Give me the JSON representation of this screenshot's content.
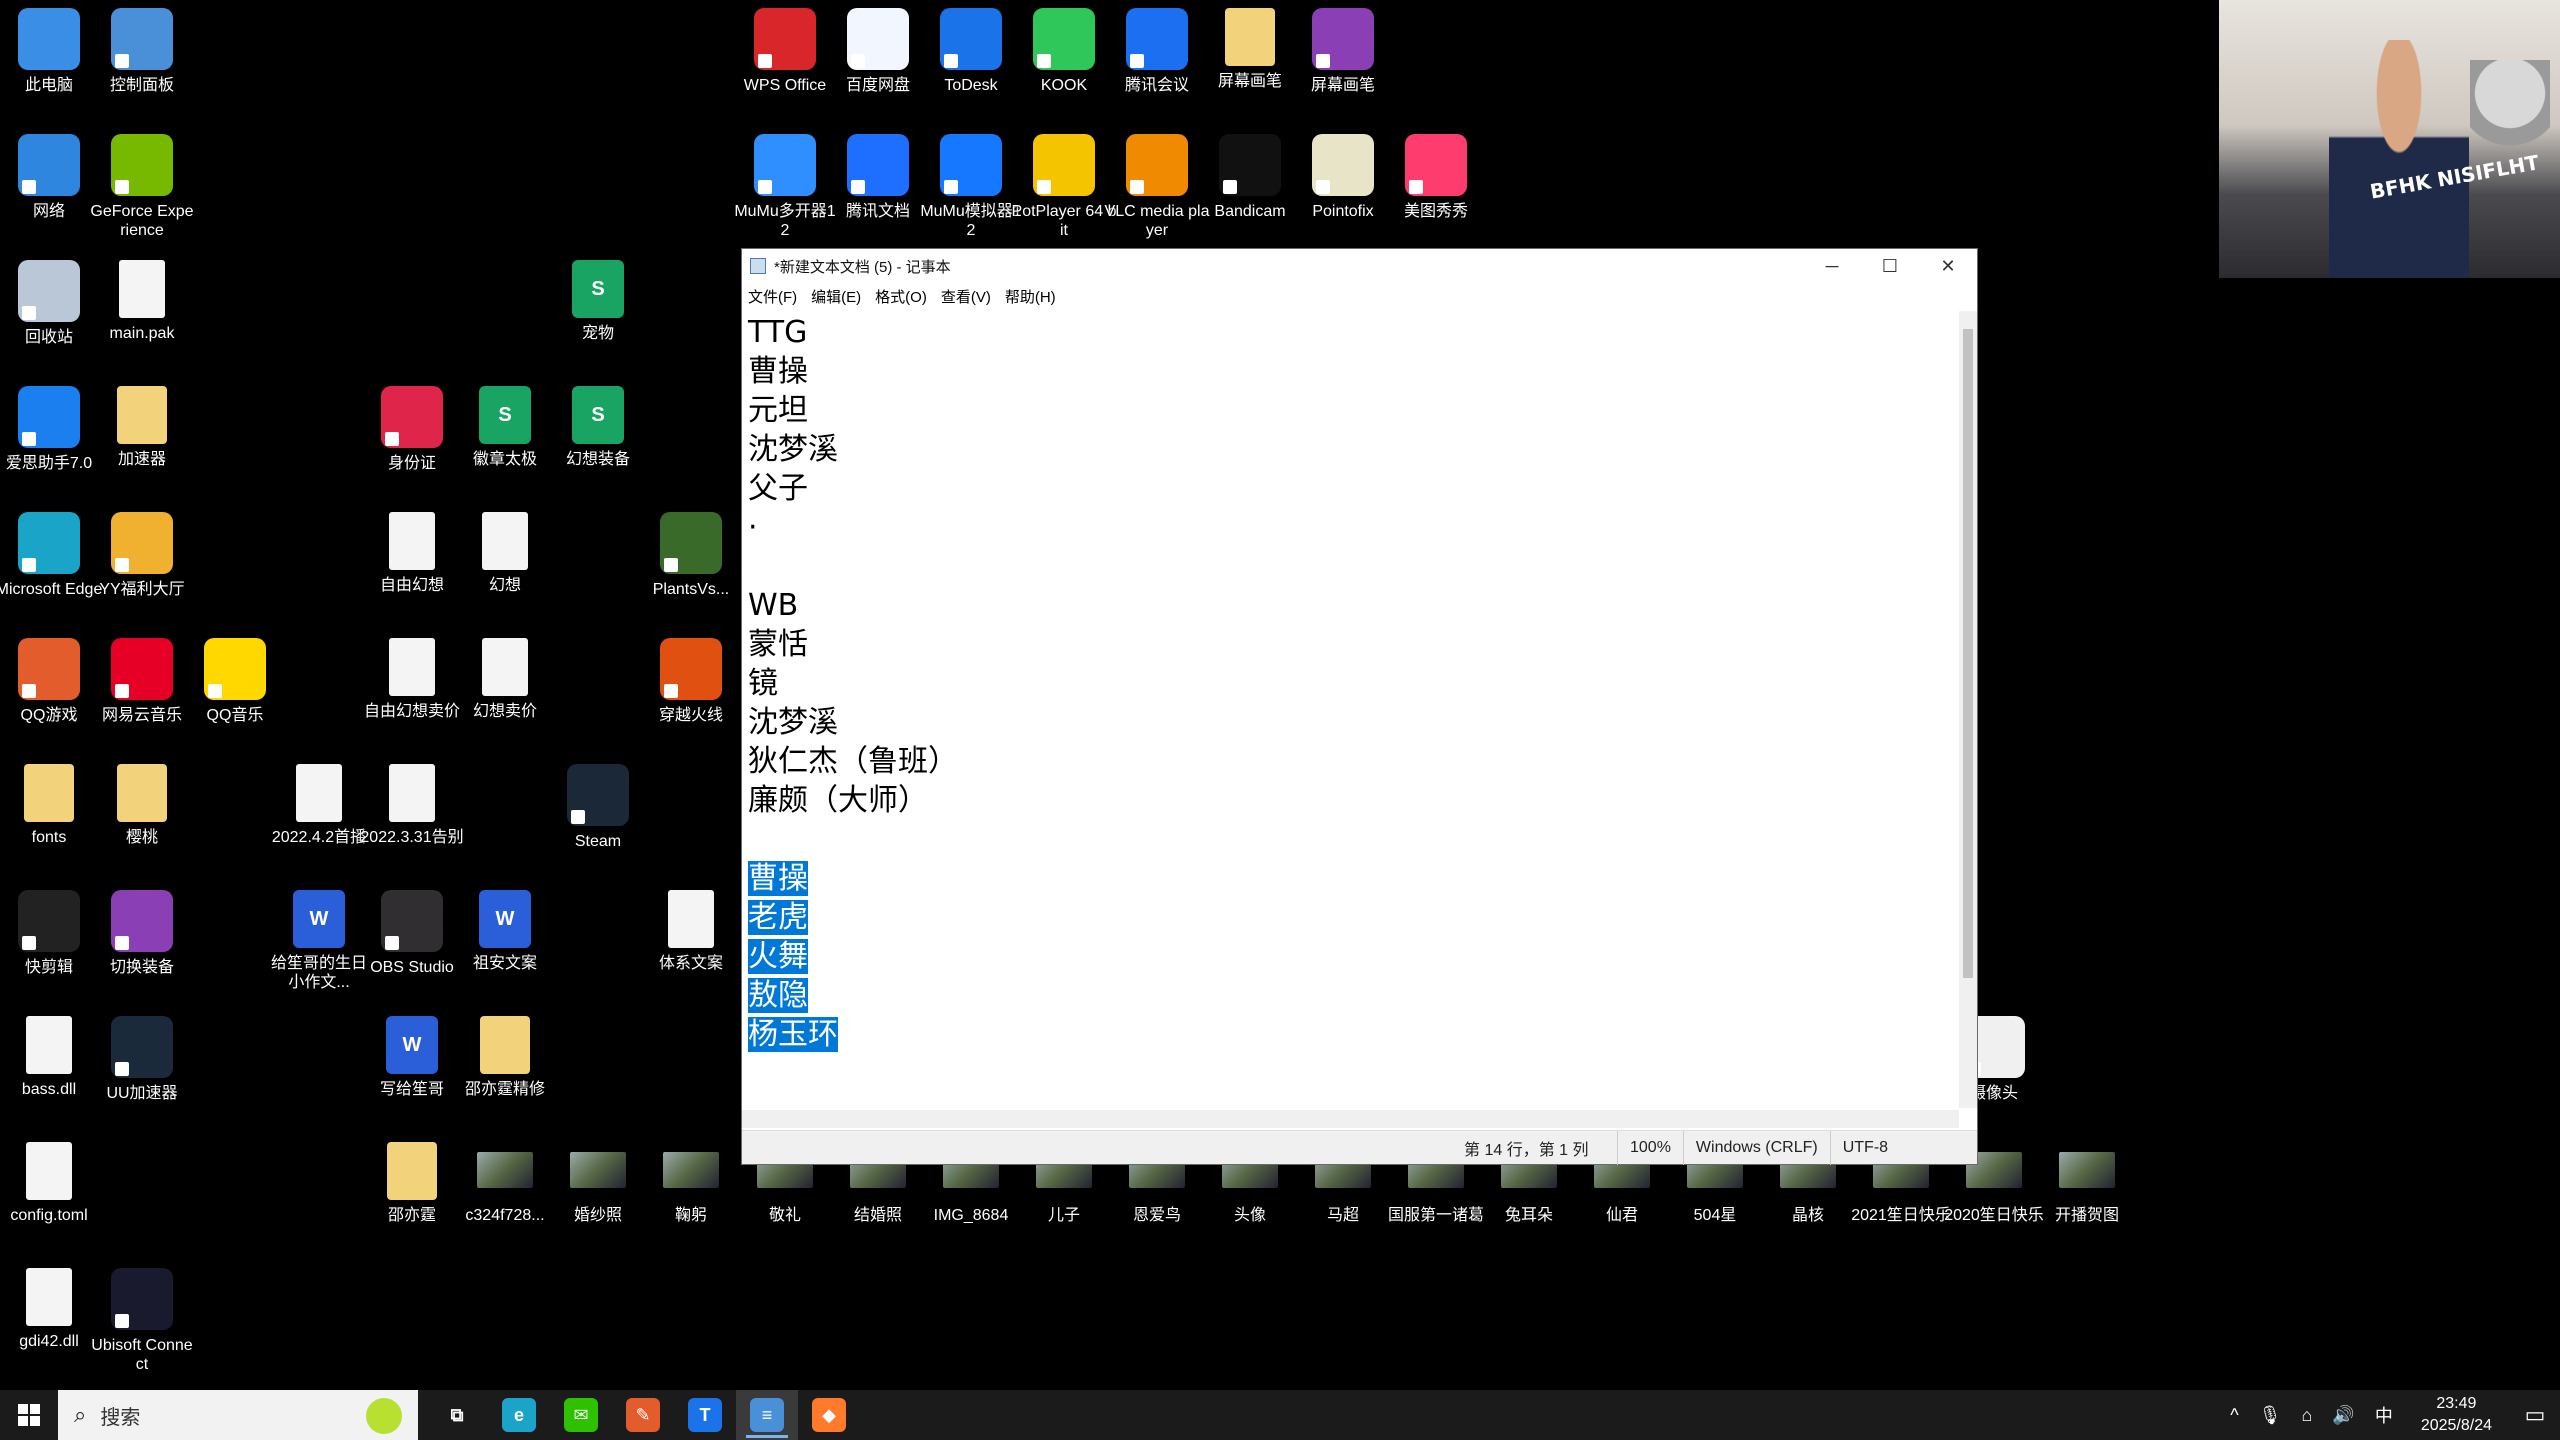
{
  "desktop_icons": [
    {
      "label": "此电脑",
      "kind": "pc",
      "color": "#3a8ee6"
    },
    {
      "label": "控制面板",
      "kind": "app",
      "color": "#4a90d9"
    },
    {
      "label": "网络",
      "kind": "app",
      "color": "#2e86de"
    },
    {
      "label": "GeForce Experience",
      "kind": "app",
      "color": "#76b900"
    },
    {
      "label": "回收站",
      "kind": "app",
      "color": "#b9c7d6"
    },
    {
      "label": "main.pak",
      "kind": "doc",
      "color": "#f4f4f4"
    },
    {
      "label": "爱思助手7.0",
      "kind": "app",
      "color": "#1b7ff0"
    },
    {
      "label": "加速器",
      "kind": "folder",
      "color": "#f2d27a"
    },
    {
      "label": "Microsoft Edge",
      "kind": "app",
      "color": "#1aa4c8"
    },
    {
      "label": "YY福利大厅",
      "kind": "app",
      "color": "#f0b030"
    },
    {
      "label": "QQ游戏",
      "kind": "app",
      "color": "#e25c2c"
    },
    {
      "label": "网易云音乐",
      "kind": "app",
      "color": "#e60026"
    },
    {
      "label": "QQ音乐",
      "kind": "app",
      "color": "#ffd800"
    },
    {
      "label": "fonts",
      "kind": "folder",
      "color": "#f2d27a"
    },
    {
      "label": "樱桃",
      "kind": "folder",
      "color": "#f2d27a"
    },
    {
      "label": "快剪辑",
      "kind": "app",
      "color": "#222222"
    },
    {
      "label": "切换装备",
      "kind": "app",
      "color": "#8a3fb5"
    },
    {
      "label": "bass.dll",
      "kind": "doc",
      "color": "#f4f4f4"
    },
    {
      "label": "UU加速器",
      "kind": "app",
      "color": "#1a2a3a"
    },
    {
      "label": "config.toml",
      "kind": "doc",
      "color": "#f4f4f4"
    },
    {
      "label": "gdi42.dll",
      "kind": "doc",
      "color": "#f4f4f4"
    },
    {
      "label": "Ubisoft Connect",
      "kind": "app",
      "color": "#1a1a2e"
    },
    {
      "label": "身份证",
      "kind": "app",
      "color": "#e0254a"
    },
    {
      "label": "徽章太极",
      "kind": "sheet",
      "color": "#1aa463"
    },
    {
      "label": "幻想装备",
      "kind": "sheet",
      "color": "#1aa463"
    },
    {
      "label": "自由幻想",
      "kind": "doc",
      "color": "#f4f4f4"
    },
    {
      "label": "幻想",
      "kind": "doc",
      "color": "#f4f4f4"
    },
    {
      "label": "自由幻想卖价",
      "kind": "doc",
      "color": "#f4f4f4"
    },
    {
      "label": "幻想卖价",
      "kind": "doc",
      "color": "#f4f4f4"
    },
    {
      "label": "2022.4.2首播",
      "kind": "doc",
      "color": "#f4f4f4"
    },
    {
      "label": "2022.3.31告别",
      "kind": "doc",
      "color": "#f4f4f4"
    },
    {
      "label": "给笙哥的生日小作文...",
      "kind": "word",
      "color": "#2b5fd9"
    },
    {
      "label": "OBS Studio",
      "kind": "app",
      "color": "#302e31"
    },
    {
      "label": "祖安文案",
      "kind": "word",
      "color": "#2b5fd9"
    },
    {
      "label": "写给笙哥",
      "kind": "word",
      "color": "#2b5fd9"
    },
    {
      "label": "邵亦霆精修",
      "kind": "folder",
      "color": "#f2d27a"
    },
    {
      "label": "邵亦霆",
      "kind": "folder",
      "color": "#f2d27a"
    },
    {
      "label": "c324f728...",
      "kind": "photo",
      "color": "#888888"
    },
    {
      "label": "婚纱照",
      "kind": "photo",
      "color": "#888888"
    },
    {
      "label": "宠物",
      "kind": "sheet",
      "color": "#1aa463"
    },
    {
      "label": "PlantsVs...",
      "kind": "app",
      "color": "#3a6a2a"
    },
    {
      "label": "穿越火线",
      "kind": "app",
      "color": "#e05010"
    },
    {
      "label": "Steam",
      "kind": "app",
      "color": "#1b2838"
    },
    {
      "label": "体系文案",
      "kind": "doc",
      "color": "#f4f4f4"
    },
    {
      "label": "鞠躬",
      "kind": "photo",
      "color": "#888888"
    },
    {
      "label": "WPS Office",
      "kind": "app",
      "color": "#d9262b"
    },
    {
      "label": "百度网盘",
      "kind": "app",
      "color": "#f2f7ff"
    },
    {
      "label": "ToDesk",
      "kind": "app",
      "color": "#1a73e8"
    },
    {
      "label": "KOOK",
      "kind": "app",
      "color": "#30c75a"
    },
    {
      "label": "腾讯会议",
      "kind": "app",
      "color": "#1d6ff2"
    },
    {
      "label": "屏幕画笔",
      "kind": "folder",
      "color": "#f2d27a"
    },
    {
      "label": "屏幕画笔",
      "kind": "app",
      "color": "#8a3fb5"
    },
    {
      "label": "MuMu多开器12",
      "kind": "app",
      "color": "#2f8fff"
    },
    {
      "label": "腾讯文档",
      "kind": "app",
      "color": "#1e6fff"
    },
    {
      "label": "MuMu模拟器12",
      "kind": "app",
      "color": "#1678ff"
    },
    {
      "label": "PotPlayer 64 bit",
      "kind": "app",
      "color": "#f5c400"
    },
    {
      "label": "VLC media player",
      "kind": "app",
      "color": "#f08a00"
    },
    {
      "label": "Bandicam",
      "kind": "app",
      "color": "#111111"
    },
    {
      "label": "Pointofix",
      "kind": "app",
      "color": "#e8e4c8"
    },
    {
      "label": "美图秀秀",
      "kind": "app",
      "color": "#ff3c6e"
    },
    {
      "label": "敬礼",
      "kind": "photo",
      "color": "#888888"
    },
    {
      "label": "结婚照",
      "kind": "photo",
      "color": "#888888"
    },
    {
      "label": "IMG_8684",
      "kind": "photo",
      "color": "#888888"
    },
    {
      "label": "儿子",
      "kind": "photo",
      "color": "#888888"
    },
    {
      "label": "恩爱鸟",
      "kind": "photo",
      "color": "#888888"
    },
    {
      "label": "头像",
      "kind": "photo",
      "color": "#888888"
    },
    {
      "label": "马超",
      "kind": "photo",
      "color": "#888888"
    },
    {
      "label": "国服第一诸葛",
      "kind": "photo",
      "color": "#888888"
    },
    {
      "label": "兔耳朵",
      "kind": "photo",
      "color": "#888888"
    },
    {
      "label": "仙君",
      "kind": "photo",
      "color": "#888888"
    },
    {
      "label": "504星",
      "kind": "photo",
      "color": "#888888"
    },
    {
      "label": "晶核",
      "kind": "photo",
      "color": "#888888"
    },
    {
      "label": "2021笙日快乐",
      "kind": "photo",
      "color": "#888888"
    },
    {
      "label": "2020笙日快乐",
      "kind": "photo",
      "color": "#888888"
    },
    {
      "label": "开播贺图",
      "kind": "photo",
      "color": "#888888"
    },
    {
      "label": "摄像头",
      "kind": "app",
      "color": "#f0f0f0"
    }
  ],
  "notepad": {
    "title": "*新建文本文档 (5) - 记事本",
    "menu": [
      "文件(F)",
      "编辑(E)",
      "格式(O)",
      "查看(V)",
      "帮助(H)"
    ],
    "lines_plain": [
      "TTG",
      "曹操",
      "元坦",
      "沈梦溪",
      "父子",
      "·",
      "",
      "WB",
      "蒙恬",
      "镜",
      "沈梦溪",
      "狄仁杰（鲁班）",
      "廉颇（大师）",
      ""
    ],
    "lines_selected": [
      "曹操",
      "老虎",
      "火舞",
      "敖隐",
      "杨玉环"
    ],
    "status": {
      "position": "第 14 行，第 1 列",
      "zoom": "100%",
      "eol": "Windows (CRLF)",
      "encoding": "UTF-8"
    },
    "controls": {
      "minimize": "─",
      "maximize": "☐",
      "close": "✕"
    }
  },
  "webcam": {
    "shirt_text": "BFHK NISIFLHT"
  },
  "taskbar": {
    "search_placeholder": "搜索",
    "apps": [
      {
        "name": "task-view",
        "glyph": "⧉",
        "color": "#1b1b1b"
      },
      {
        "name": "edge",
        "glyph": "e",
        "color": "#1aa4c8"
      },
      {
        "name": "wechat",
        "glyph": "✉",
        "color": "#2dc100"
      },
      {
        "name": "paint",
        "glyph": "✎",
        "color": "#e25c2c"
      },
      {
        "name": "todesk",
        "glyph": "T",
        "color": "#1a73e8"
      },
      {
        "name": "notepad",
        "glyph": "≡",
        "color": "#4a90d9"
      },
      {
        "name": "game",
        "glyph": "◆",
        "color": "#ff7a2a"
      }
    ],
    "ime": "中",
    "time": "23:49",
    "date": "2025/8/24"
  }
}
